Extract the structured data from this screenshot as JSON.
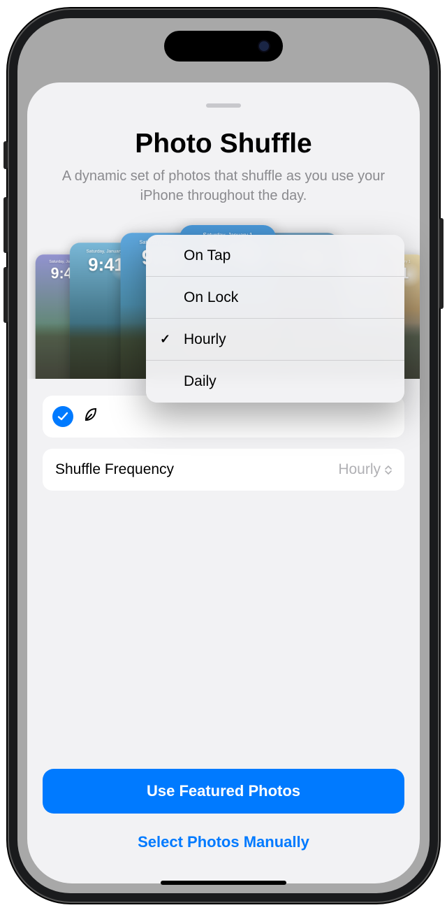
{
  "sheet": {
    "title": "Photo Shuffle",
    "subtitle": "A dynamic set of photos that shuffle as you use your iPhone throughout the day."
  },
  "carousel": {
    "date_label": "Saturday, January 1",
    "time_label": "9:41"
  },
  "frequency": {
    "label": "Shuffle Frequency",
    "value": "Hourly",
    "options": [
      {
        "label": "On Tap",
        "selected": false
      },
      {
        "label": "On Lock",
        "selected": false
      },
      {
        "label": "Hourly",
        "selected": true
      },
      {
        "label": "Daily",
        "selected": false
      }
    ]
  },
  "actions": {
    "primary": "Use Featured Photos",
    "secondary": "Select Photos Manually"
  },
  "colors": {
    "accent": "#007aff"
  }
}
